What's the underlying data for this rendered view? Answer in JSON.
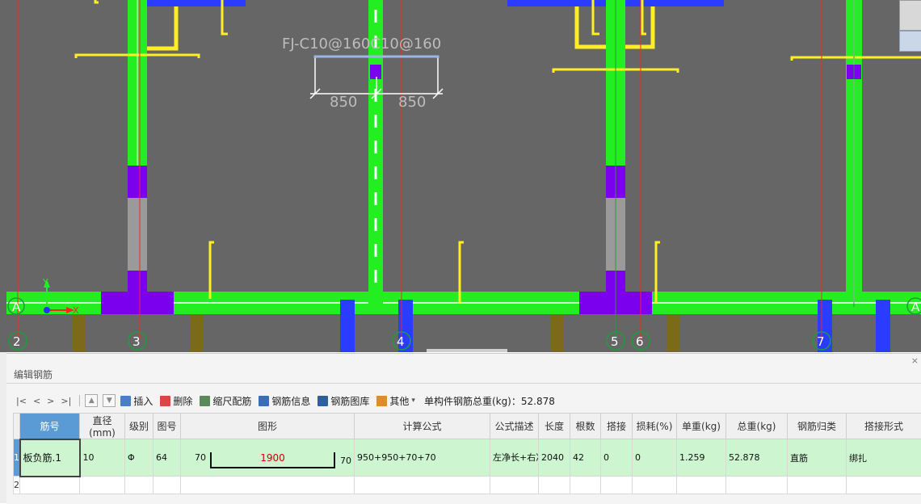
{
  "colors": {
    "canvas_bg": "#666666",
    "wall_green": "#22ee22",
    "column_purple": "#7a00ee",
    "column_blue": "#2a3cff",
    "rebar_yellow": "#ffee22",
    "grid_red": "#ff2222",
    "axis_circle": "#1f9c3a",
    "brown_post": "#7a6a1a",
    "selected_row": "#ccf5d0",
    "header_blue": "#5b9bd5",
    "shape_red": "#d00000"
  },
  "canvas": {
    "rebar_label": "FJ-C10@160C10@160",
    "dimension_left": "850",
    "dimension_right": "850",
    "axis_numbers": [
      "2",
      "3",
      "4",
      "5",
      "6",
      "7"
    ],
    "axis_letters": [
      "A",
      "A"
    ],
    "ucs": {
      "y_label": "Y",
      "x_label": "X"
    }
  },
  "panel": {
    "title": "编辑钢筋",
    "close_icon": "close-icon"
  },
  "toolbar": {
    "nav_buttons": [
      "|<",
      "<",
      ">",
      ">|"
    ],
    "insert_label": "插入",
    "delete_label": "删除",
    "scale_label": "缩尺配筋",
    "info_label": "钢筋信息",
    "library_label": "钢筋图库",
    "other_label": "其他",
    "total_label": "单构件钢筋总重(kg)：52.878"
  },
  "table": {
    "columns": [
      "筋号",
      "直径(mm)",
      "级别",
      "图号",
      "图形",
      "计算公式",
      "公式描述",
      "长度",
      "根数",
      "搭接",
      "损耗(%)",
      "单重(kg)",
      "总重(kg)",
      "钢筋归类",
      "搭接形式"
    ],
    "rows": [
      {
        "index": "1",
        "name": "板负筋.1",
        "diameter": "10",
        "grade": "Φ",
        "figure_no": "64",
        "shape_left": "70",
        "shape_mid": "1900",
        "shape_right": "70",
        "formula": "950+950+70+70",
        "description": "左净长+右净长+…",
        "length": "2040",
        "count": "42",
        "lap": "0",
        "loss": "0",
        "unit_weight": "1.259",
        "total_weight": "52.878",
        "category": "直筋",
        "lap_type": "绑扎"
      }
    ],
    "empty_row_index": "2"
  }
}
